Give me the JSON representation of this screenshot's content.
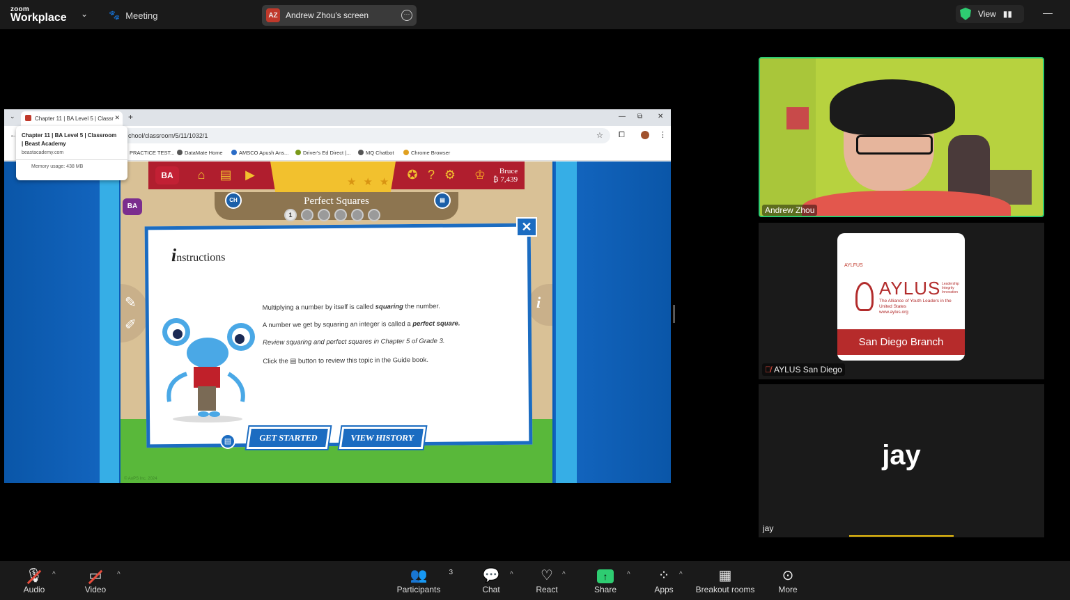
{
  "topbar": {
    "logo_small": "zoom",
    "logo_big": "Workplace",
    "meeting_label": "Meeting",
    "share_initials": "AZ",
    "share_label": "Andrew Zhou's screen",
    "view_label": "View"
  },
  "browser": {
    "tab_title": "Chapter 11 | BA Level 5 | Classr",
    "url": "chool/classroom/5/11/1032/1",
    "hover_card": {
      "title": "Chapter 11 | BA Level 5 | Classroom | Beast Academy",
      "domain": "beastacademy.com",
      "memory": "Memory usage: 438 MB"
    },
    "bookmarks": [
      "PRACTICE TEST...",
      "DataMate Home",
      "AMSCO Apush Ans...",
      "Driver's Ed Direct |...",
      "MQ Chatbot",
      "Chrome Browser"
    ]
  },
  "game": {
    "bruce_name": "Bruce",
    "bruce_coins": "₿ 7,439",
    "title": "Perfect Squares",
    "ch_label": "CH",
    "level_dots": [
      "1",
      "",
      "",
      "",
      "",
      ""
    ],
    "instructions_heading_initial": "i",
    "instructions_heading_rest": "nstructions",
    "line1_pre": "Multiplying a number by itself is called ",
    "line1_em": "squaring",
    "line1_post": " the number.",
    "line2_pre": "A number we get by squaring an integer is called a ",
    "line2_em": "perfect square.",
    "line3": "Review squaring and perfect squares in Chapter 5 of Grade 3.",
    "line4_pre": "Click the ",
    "line4_post": " button to review this topic in the Guide book.",
    "get_started": "GET STARTED",
    "view_history": "VIEW HISTORY",
    "copyright": "© AoPS Inc. 2024"
  },
  "participants": {
    "video_name": "Andrew Zhou",
    "aylus_small": "AYLFUS",
    "aylus_big": "AYLUS",
    "aylus_tagline": "Leadership Integrity Innovation",
    "aylus_sub": "The Alliance of Youth Leaders in the United States",
    "aylus_url": "www.aylus.org",
    "aylus_branch": "San Diego Branch",
    "aylus_label": "AYLUS San Diego",
    "jay_big": "jay",
    "jay_label": "jay"
  },
  "toolbar": {
    "audio": "Audio",
    "video": "Video",
    "participants": "Participants",
    "participants_count": "3",
    "chat": "Chat",
    "react": "React",
    "share": "Share",
    "apps": "Apps",
    "breakout": "Breakout rooms",
    "more": "More"
  }
}
